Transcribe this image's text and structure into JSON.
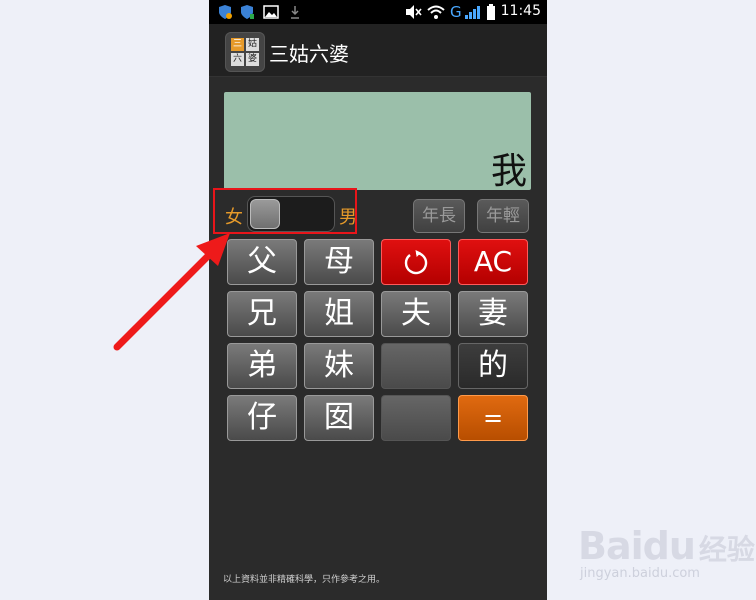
{
  "status_bar": {
    "time": "11:45",
    "network": "G",
    "icons": [
      "shield-icon",
      "shield-icon",
      "image-icon",
      "download-icon",
      "mute-icon",
      "wifi-icon",
      "signal-icon",
      "battery-icon"
    ]
  },
  "app": {
    "title": "三姑六婆",
    "icon_cells": [
      "三",
      "姑",
      "六",
      "婆"
    ],
    "accent_color": "#e69a2a"
  },
  "display": {
    "text": "我"
  },
  "gender_toggle": {
    "left_label": "女",
    "right_label": "男"
  },
  "age_buttons": [
    "年長",
    "年輕"
  ],
  "keys": [
    [
      "父",
      "母",
      "↺",
      "AC"
    ],
    [
      "兄",
      "姐",
      "夫",
      "妻"
    ],
    [
      "弟",
      "妹",
      "",
      "的"
    ],
    [
      "仔",
      "囡",
      "",
      "="
    ]
  ],
  "footer": {
    "text": "以上資料並非精確科學，只作參考之用。"
  },
  "watermark": {
    "brand": "Baidu",
    "brand_cn": "经验",
    "url": "jingyan.baidu.com"
  }
}
